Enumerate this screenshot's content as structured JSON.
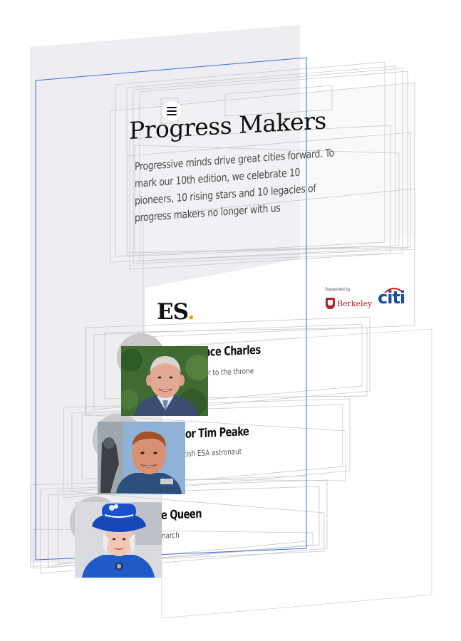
{
  "page": {
    "title": "Progress Makers",
    "intro": "Progressive minds drive great cities forward. To mark our 10th edition, we celebrate 10 pioneers, 10 rising stars and 10 legacies of progress makers no longer with us",
    "menu_icon": "hamburger-menu-icon"
  },
  "brand": {
    "logo_text": "ES",
    "logo_dot": ".",
    "logo_dot_color": "#f39c12",
    "supported_by": "Supported by",
    "sponsor_1": "Berkeley",
    "sponsor_1_color": "#b0262c",
    "sponsor_2": "citi",
    "sponsor_2_color": "#1c4fa2"
  },
  "people": [
    {
      "name_visible": "nce Charles",
      "description_visible": "r to the throne",
      "photo": "prince-charles-photo"
    },
    {
      "name_visible": "jor Tim Peake",
      "description_visible": "tish ESA astronaut",
      "photo": "tim-peake-photo"
    },
    {
      "name_visible": "e Queen",
      "description_visible": "narch",
      "photo": "the-queen-photo"
    }
  ],
  "colors": {
    "overlay_panel": "#ededf2",
    "outline_blue": "#3b6fd4",
    "outline_gray": "#c8c8cc"
  }
}
